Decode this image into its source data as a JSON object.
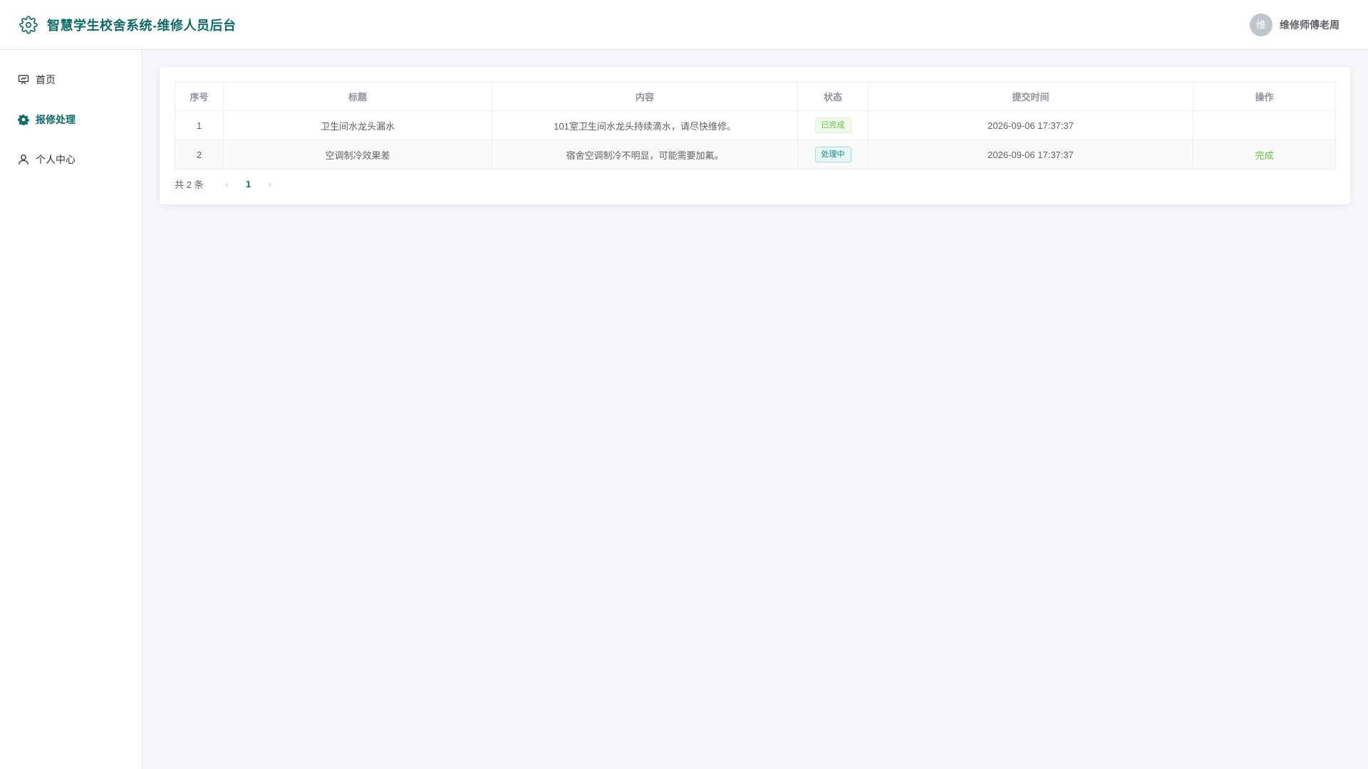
{
  "header": {
    "title": "智慧学生校舍系统-维修人员后台",
    "logo_icon": "gear-icon",
    "user": {
      "avatar_text": "维",
      "name": "维修师傅老周"
    }
  },
  "sidebar": {
    "items": [
      {
        "label": "首页",
        "icon": "presentation-board-icon",
        "active": false
      },
      {
        "label": "报修处理",
        "icon": "gear-icon",
        "active": true
      },
      {
        "label": "个人中心",
        "icon": "user-icon",
        "active": false
      }
    ]
  },
  "table": {
    "columns": [
      "序号",
      "标题",
      "内容",
      "状态",
      "提交时间",
      "操作"
    ],
    "rows": [
      {
        "index": "1",
        "title": "卫生间水龙头漏水",
        "content": "101室卫生间水龙头持续滴水，请尽快维修。",
        "status": "已完成",
        "time": "2026-09-06 17:37:37",
        "action": ""
      },
      {
        "index": "2",
        "title": "空调制冷效果差",
        "content": "宿舍空调制冷不明显，可能需要加氟。",
        "status": "处理中",
        "time": "2026-09-06 17:37:37",
        "action": "完成"
      }
    ]
  },
  "pagination": {
    "total_text": "共 2 条",
    "prev": "‹",
    "current": "1",
    "next": "›"
  },
  "colors": {
    "brand": "#0f6b68",
    "success": "#67c23a",
    "processing": "#0f8a80"
  }
}
